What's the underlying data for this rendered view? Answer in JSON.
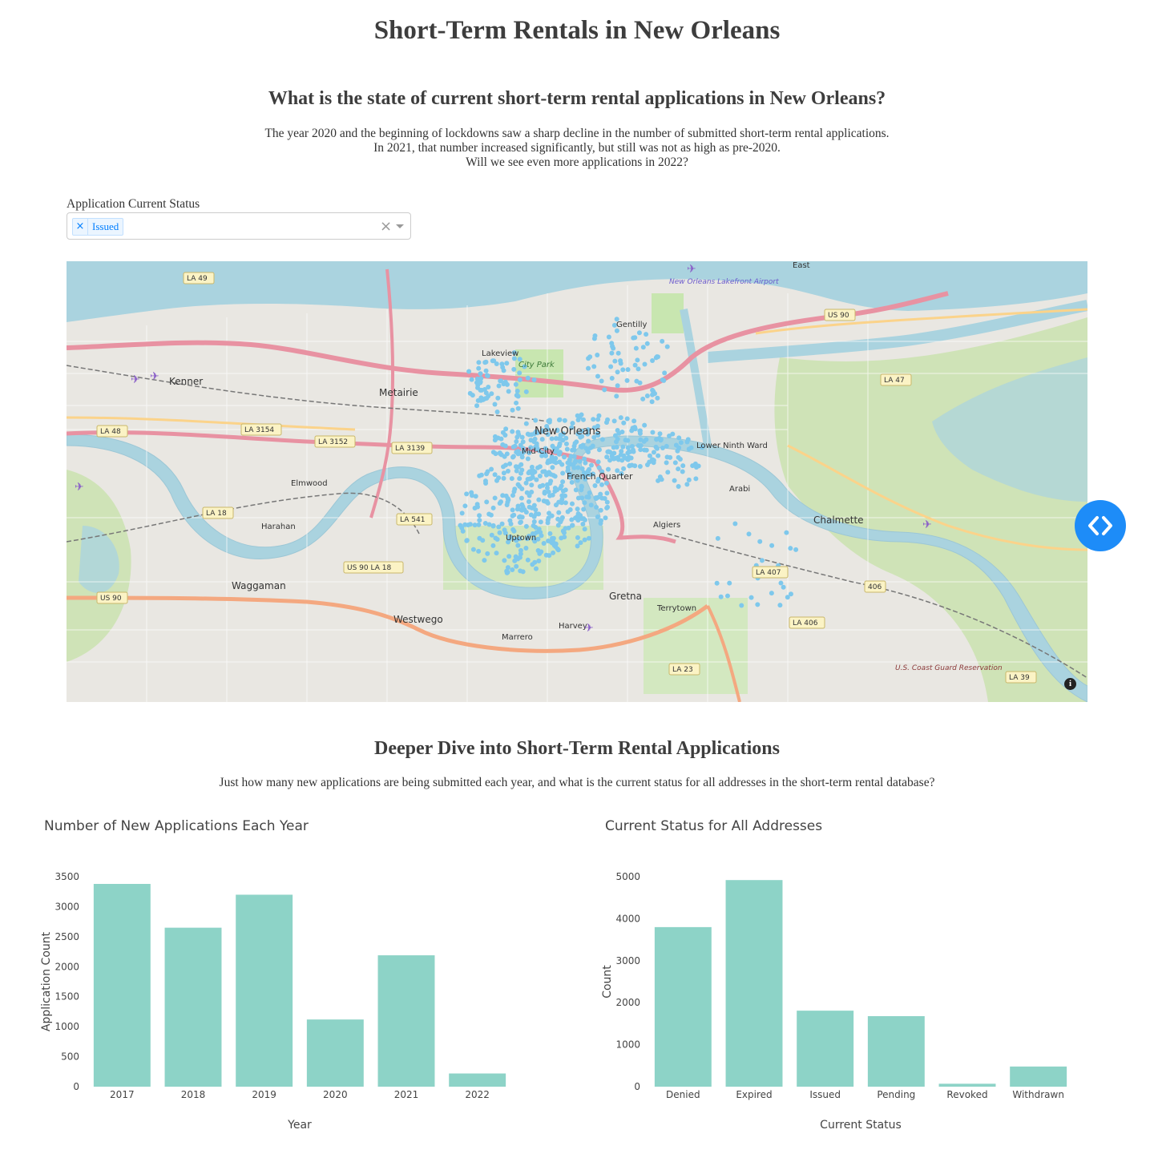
{
  "page": {
    "title": "Short-Term Rentals in New Orleans"
  },
  "section1": {
    "heading": "What is the state of current short-term rental applications in New Orleans?",
    "intro_lines": [
      "The year 2020 and the beginning of lockdowns saw a sharp decline in the number of submitted short-term rental applications.",
      "In 2021, that number increased significantly, but still was not as high as pre-2020.",
      "Will we see even more applications in 2022?"
    ]
  },
  "filter": {
    "label": "Application Current Status",
    "selected": [
      "Issued"
    ],
    "chip_remove": "×",
    "clear": "×"
  },
  "map": {
    "labels": [
      "Kenner",
      "Metairie",
      "New Orleans",
      "Mid-City",
      "French Quarter",
      "Lakeview",
      "City Park",
      "Gentilly",
      "Elmwood",
      "Harahan",
      "Waggaman",
      "Westwego",
      "Marrero",
      "Harvey",
      "Gretna",
      "Terrytown",
      "Algiers",
      "Arabi",
      "Chalmette",
      "Lower Ninth Ward",
      "New Orleans Lakefront Airport",
      "U.S. Coast Guard Reservation",
      "Uptown",
      "East"
    ],
    "shields": [
      "LA 49",
      "LA 48",
      "LA 3154",
      "LA 3152",
      "LA 3139",
      "LA 18",
      "LA 541",
      "US 90",
      "US 90 LA 18",
      "LA 407",
      "LA 406",
      "LA 23",
      "LA 39",
      "LA 47",
      "406",
      "US 90"
    ],
    "point_color": "#7ec8ec",
    "info": "i"
  },
  "section2": {
    "heading": "Deeper Dive into Short-Term Rental Applications",
    "sub": "Just how many new applications are being submitted each year, and what is the current status for all addresses in the short-term rental database?"
  },
  "chart_data": [
    {
      "type": "bar",
      "title": "Number of New Applications Each Year",
      "xlabel": "Year",
      "ylabel": "Application Count",
      "categories": [
        "2017",
        "2018",
        "2019",
        "2020",
        "2021",
        "2022"
      ],
      "values": [
        3380,
        2650,
        3200,
        1120,
        2190,
        220
      ],
      "ylim": [
        0,
        3500
      ],
      "yticks": [
        0,
        500,
        1000,
        1500,
        2000,
        2500,
        3000,
        3500
      ],
      "color": "#8dd3c7"
    },
    {
      "type": "bar",
      "title": "Current Status for All Addresses",
      "xlabel": "Current Status",
      "ylabel": "Count",
      "categories": [
        "Denied",
        "Expired",
        "Issued",
        "Pending",
        "Revoked",
        "Withdrawn"
      ],
      "values": [
        3800,
        4920,
        1810,
        1680,
        70,
        480
      ],
      "ylim": [
        0,
        5000
      ],
      "yticks": [
        0,
        1000,
        2000,
        3000,
        4000,
        5000
      ],
      "color": "#8dd3c7"
    }
  ]
}
